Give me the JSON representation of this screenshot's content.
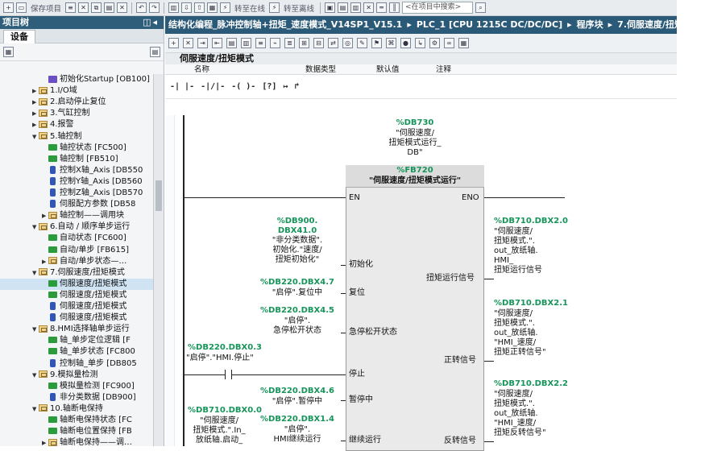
{
  "toolbar": {
    "save_project": "保存项目",
    "go_online": "转至在线",
    "go_offline": "转至离线",
    "search_placeholder": "<在项目中搜索>"
  },
  "project_tree": {
    "title": "项目树",
    "device_tab": "设备",
    "items": [
      {
        "label": "初始化Startup [OB100]",
        "type": "ob",
        "level": 3,
        "expanded": null
      },
      {
        "label": "1.I/O域",
        "type": "folder",
        "level": 2,
        "expanded": false
      },
      {
        "label": "2.启动停止复位",
        "type": "folder",
        "level": 2,
        "expanded": false
      },
      {
        "label": "3.气缸控制",
        "type": "folder",
        "level": 2,
        "expanded": false
      },
      {
        "label": "4.报警",
        "type": "folder",
        "level": 2,
        "expanded": false
      },
      {
        "label": "5.轴控制",
        "type": "folder",
        "level": 2,
        "expanded": true
      },
      {
        "label": "轴控状态 [FC500]",
        "type": "fb",
        "level": 3,
        "expanded": null
      },
      {
        "label": "轴控制 [FB510]",
        "type": "fb",
        "level": 3,
        "expanded": null
      },
      {
        "label": "控制X轴_Axis [DB550",
        "type": "db",
        "level": 3,
        "expanded": null
      },
      {
        "label": "控制Y轴_Axis [DB560",
        "type": "db",
        "level": 3,
        "expanded": null
      },
      {
        "label": "控制Z轴_Axis [DB570",
        "type": "db",
        "level": 3,
        "expanded": null
      },
      {
        "label": "伺服配方参数 [DB58",
        "type": "db",
        "level": 3,
        "expanded": null
      },
      {
        "label": "轴控制——调用块",
        "type": "folder",
        "level": 3,
        "expanded": false
      },
      {
        "label": "6.自动 / 顺序单步运行",
        "type": "folder",
        "level": 2,
        "expanded": true
      },
      {
        "label": "自动状态 [FC600]",
        "type": "fb",
        "level": 3,
        "expanded": null
      },
      {
        "label": "自动/单步 [FB615]",
        "type": "fb",
        "level": 3,
        "expanded": null
      },
      {
        "label": "自动/单步状态—…",
        "type": "folder",
        "level": 3,
        "expanded": false
      },
      {
        "label": "7.伺服速度/扭矩模式",
        "type": "folder",
        "level": 2,
        "expanded": true
      },
      {
        "label": "伺服速度/扭矩模式",
        "type": "fb",
        "level": 3,
        "expanded": null,
        "selected": true
      },
      {
        "label": "伺服速度/扭矩模式",
        "type": "fb",
        "level": 3,
        "expanded": null
      },
      {
        "label": "伺服速度/扭矩模式",
        "type": "db",
        "level": 3,
        "expanded": null
      },
      {
        "label": "伺服速度/扭矩模式",
        "type": "db",
        "level": 3,
        "expanded": null
      },
      {
        "label": "8.HMI选择轴单步运行",
        "type": "folder",
        "level": 2,
        "expanded": true
      },
      {
        "label": "轴_单步定位逻辑 [F",
        "type": "fb",
        "level": 3,
        "expanded": null
      },
      {
        "label": "轴_单步状态 [FC800",
        "type": "fb",
        "level": 3,
        "expanded": null
      },
      {
        "label": "控制轴_单步 [DB805",
        "type": "db",
        "level": 3,
        "expanded": null
      },
      {
        "label": "9.模拟量检测",
        "type": "folder",
        "level": 2,
        "expanded": true
      },
      {
        "label": "模拟量检测 [FC900]",
        "type": "fb",
        "level": 3,
        "expanded": null
      },
      {
        "label": "非分类数据 [DB900]",
        "type": "db",
        "level": 3,
        "expanded": null
      },
      {
        "label": "10.轴断电保持",
        "type": "folder",
        "level": 2,
        "expanded": true
      },
      {
        "label": "轴断电保持状态 [FC",
        "type": "fb",
        "level": 3,
        "expanded": null
      },
      {
        "label": "轴断电位置保持 [FB",
        "type": "fb",
        "level": 3,
        "expanded": null
      },
      {
        "label": "轴断电保持——调…",
        "type": "folder",
        "level": 3,
        "expanded": false
      }
    ]
  },
  "breadcrumb": [
    "结构化编程_脉冲控制轴+扭矩_速度模式_V14SP1_V15.1",
    "PLC_1 [CPU 1215C DC/DC/DC]",
    "程序块",
    "7.伺服速度/扭矩模"
  ],
  "editor": {
    "block_title": "伺服速度/扭矩模式",
    "interface_columns": [
      "名称",
      "数据类型",
      "默认值",
      "注释"
    ]
  },
  "network": {
    "instance_db_addr": "%DB730",
    "instance_db_name": [
      "\"伺服速度/",
      "扭矩模式运行_",
      "DB\""
    ],
    "fb_addr": "%FB720",
    "fb_name": "\"伺服速度/扭矩模式运行\"",
    "en": "EN",
    "eno": "ENO",
    "inputs": [
      {
        "pin": "初始化",
        "addr": [
          "%DB900.",
          "DBX41.0"
        ],
        "tag": [
          "\"非分类数据\".",
          "初始化.\"速度/",
          "扭矩初始化\""
        ]
      },
      {
        "pin": "复位",
        "addr": [
          "%DB220.DBX4.7"
        ],
        "tag": [
          "\"启停\".复位中"
        ]
      },
      {
        "pin": "急停松开状态",
        "addr": [
          "%DB220.DBX4.5"
        ],
        "tag": [
          "\"启停\".",
          "急停松开状态"
        ]
      },
      {
        "pin": "停止",
        "addr": [
          "%DB220.DBX0.3"
        ],
        "tag": [
          "\"启停\".\"HMI.停止\""
        ]
      },
      {
        "pin": "暂停中",
        "addr": [
          "%DB220.DBX4.6"
        ],
        "tag": [
          "\"启停\".暂停中"
        ]
      },
      {
        "pin": "继续运行",
        "addr": [
          "%DB220.DBX1.4"
        ],
        "tag": [
          "\"启停\".",
          "HMI继续运行"
        ]
      }
    ],
    "left_extra": {
      "addr": [
        "%DB710.DBX0.0"
      ],
      "tag": [
        "\"伺服速度/",
        "扭矩模式.\".In_",
        "放纸轴.启动_"
      ]
    },
    "outputs": [
      {
        "pin": "扭矩运行信号",
        "addr": [
          "%DB710.DBX2.0"
        ],
        "tag": [
          "\"伺服速度/",
          "扭矩模式.\".",
          "out_放纸轴.",
          "HMI_",
          "扭矩运行信号"
        ]
      },
      {
        "pin": "正转信号",
        "addr": [
          "%DB710.DBX2.1"
        ],
        "tag": [
          "\"伺服速度/",
          "扭矩模式.\".",
          "out_放纸轴.",
          "\"HMI_速度/",
          "扭矩正转信号\""
        ]
      },
      {
        "pin": "反转信号",
        "addr": [
          "%DB710.DBX2.2"
        ],
        "tag": [
          "\"伺服速度/",
          "扭矩模式.\".",
          "out_放纸轴.",
          "\"HMI_速度/",
          "扭矩反转信号\""
        ]
      }
    ]
  },
  "colors": {
    "header_bg": "#2b5a78",
    "address_green": "#17945a",
    "selection": "#cfe3f3",
    "fb_body": "#eaeaea"
  }
}
